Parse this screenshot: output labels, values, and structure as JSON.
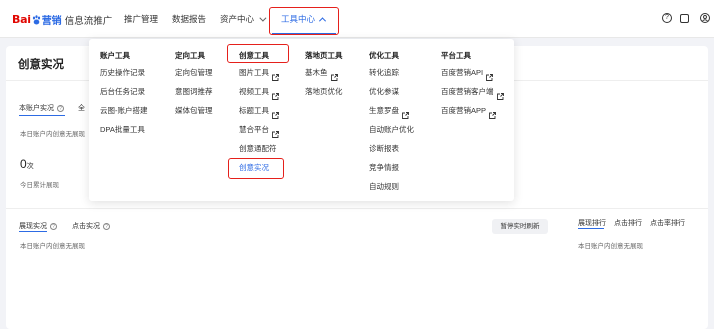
{
  "header": {
    "logo_bai": "Bai",
    "logo_brand": "营销",
    "logo_sub": "信息流推广",
    "nav": [
      {
        "label": "推广管理"
      },
      {
        "label": "数据报告"
      },
      {
        "label": "资产中心"
      },
      {
        "label": "工具中心"
      }
    ],
    "icons": [
      "help-icon",
      "copy-icon",
      "user-icon"
    ]
  },
  "page": {
    "title": "创意实况",
    "account_tab": "本账户实况",
    "account_tab2": "全",
    "no_data_today": "本日账户内创意无展现",
    "count_value": "0",
    "count_unit": "次",
    "count_label": "今日累计展现",
    "tab_display": "展现实况",
    "tab_click": "点击实况",
    "no_display": "本日账户内创意无展现",
    "refresh_button": "暂停实时刷新",
    "rank_tabs": [
      "展现排行",
      "点击排行",
      "点击率排行"
    ],
    "rank_empty": "本日账户内创意无展现"
  },
  "tools_menu": {
    "columns": [
      {
        "title": "账户工具",
        "items": [
          {
            "label": "历史操作记录"
          },
          {
            "label": "后台任务记录"
          },
          {
            "label": "云图-账户搭建"
          },
          {
            "label": "DPA批量工具"
          }
        ]
      },
      {
        "title": "定向工具",
        "items": [
          {
            "label": "定向包管理"
          },
          {
            "label": "意图词推荐"
          },
          {
            "label": "媒体包管理"
          }
        ]
      },
      {
        "title": "创意工具",
        "items": [
          {
            "label": "图片工具",
            "external": true
          },
          {
            "label": "视频工具",
            "external": true
          },
          {
            "label": "标题工具",
            "external": true
          },
          {
            "label": "慧合平台",
            "external": true
          },
          {
            "label": "创意通配符"
          },
          {
            "label": "创意实况",
            "selected": true
          }
        ]
      },
      {
        "title": "落地页工具",
        "items": [
          {
            "label": "基木鱼",
            "external": true
          },
          {
            "label": "落地页优化"
          }
        ]
      },
      {
        "title": "优化工具",
        "items": [
          {
            "label": "转化追踪"
          },
          {
            "label": "优化参谋"
          },
          {
            "label": "生意罗盘",
            "external": true
          },
          {
            "label": "自动账户优化"
          },
          {
            "label": "诊断报表"
          },
          {
            "label": "竞争情报"
          },
          {
            "label": "自动规则"
          }
        ]
      },
      {
        "title": "平台工具",
        "items": [
          {
            "label": "百度营销API",
            "external": true
          },
          {
            "label": "百度营销客户端",
            "external": true
          },
          {
            "label": "百度营销APP",
            "external": true
          }
        ]
      }
    ]
  },
  "colors": {
    "accent": "#2d6be4",
    "highlight": "#e5201b",
    "logo_red": "#e10601"
  }
}
